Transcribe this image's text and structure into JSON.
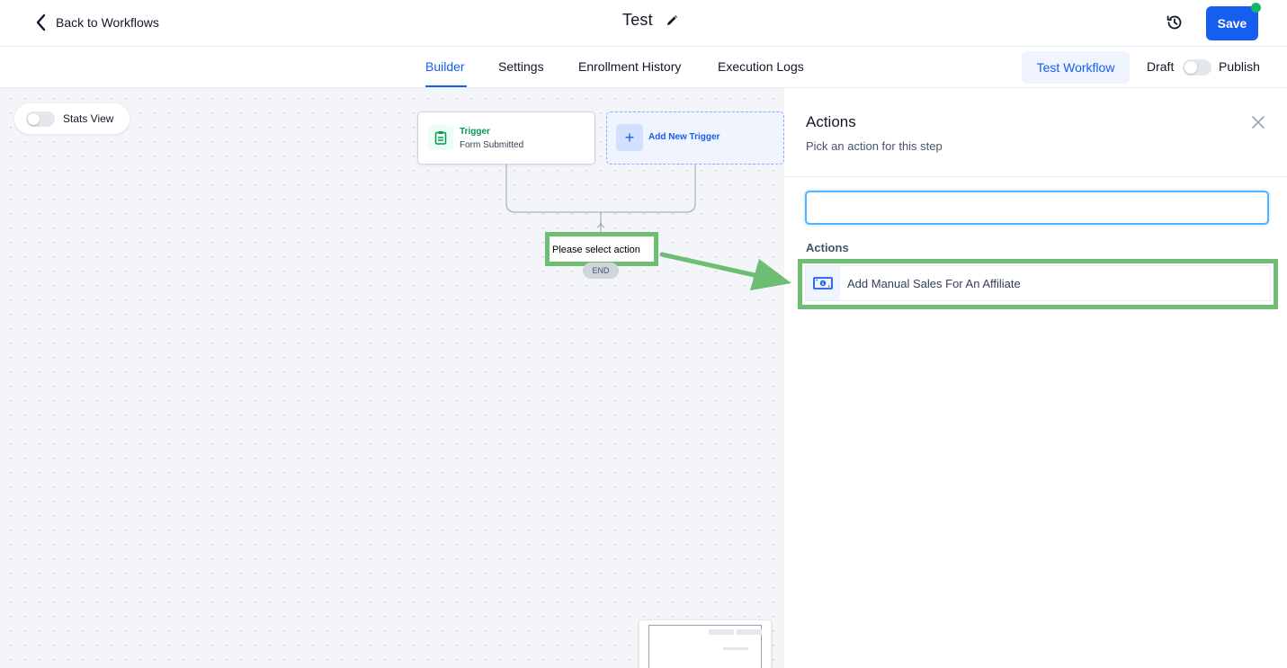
{
  "header": {
    "back_label": "Back to Workflows",
    "title": "Test",
    "save_label": "Save",
    "icons": {
      "back": "chevron-left-icon",
      "edit": "pencil-icon",
      "history": "history-icon"
    },
    "colors": {
      "primary": "#155eef",
      "status_dot": "#12b76a"
    }
  },
  "tabs": [
    {
      "label": "Builder",
      "active": true
    },
    {
      "label": "Settings",
      "active": false
    },
    {
      "label": "Enrollment History",
      "active": false
    },
    {
      "label": "Execution Logs",
      "active": false
    }
  ],
  "toolbar": {
    "test_label": "Test Workflow",
    "draft_label": "Draft",
    "publish_label": "Publish",
    "publish_toggle_on": false
  },
  "canvas": {
    "stats_label": "Stats View",
    "stats_toggle_on": false,
    "trigger": {
      "title": "Trigger",
      "subtitle": "Form Submitted",
      "icon": "clipboard-icon"
    },
    "add_trigger_label": "Add New Trigger",
    "select_action_label": "Please select action",
    "end_label": "END",
    "highlight_color": "#6dbd72"
  },
  "panel": {
    "title": "Actions",
    "subtitle": "Pick an action for this step",
    "search": {
      "value": "",
      "placeholder": ""
    },
    "section_label": "Actions",
    "actions": [
      {
        "label": "Add Manual Sales For An Affiliate",
        "icon": "money-bill-icon"
      }
    ]
  }
}
